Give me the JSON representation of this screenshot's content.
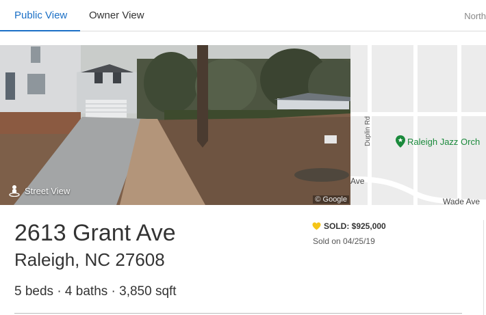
{
  "tabs": {
    "public_label": "Public View",
    "owner_label": "Owner View",
    "north_label": "North"
  },
  "photo": {
    "street_view_label": "Street View",
    "credit": "© Google"
  },
  "map": {
    "poi_label": "Raleigh Jazz Orch",
    "street_duplin": "Duplin Rd",
    "street_wade": "Wade Ave",
    "street_ave_fragment": "Ave"
  },
  "listing": {
    "address": "2613 Grant Ave",
    "city_state_zip": "Raleigh, NC 27608",
    "facts": "5 beds · 4 baths · 3,850 sqft",
    "sold_label": "SOLD: $925,000",
    "sold_date": "Sold on 04/25/19"
  },
  "colors": {
    "accent": "#1a6fc6",
    "badge": "#f5c518",
    "poi": "#1b8a3c"
  }
}
